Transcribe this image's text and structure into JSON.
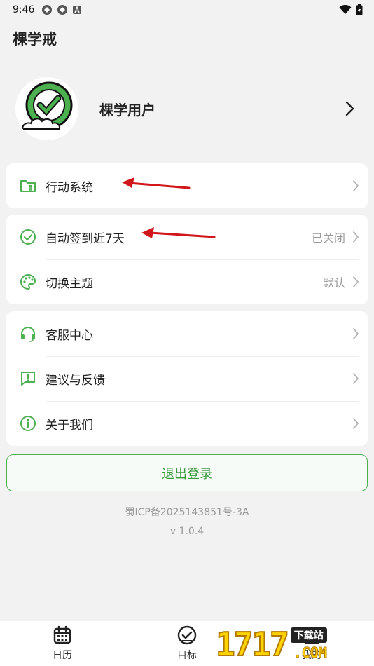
{
  "status_bar": {
    "time": "9:46"
  },
  "app": {
    "title": "棵学戒"
  },
  "profile": {
    "name": "棵学用户"
  },
  "menu_groups": [
    {
      "items": [
        {
          "label": "行动系统",
          "value": ""
        }
      ]
    },
    {
      "items": [
        {
          "label": "自动签到近7天",
          "value": "已关闭"
        },
        {
          "label": "切换主题",
          "value": "默认"
        }
      ]
    },
    {
      "items": [
        {
          "label": "客服中心",
          "value": ""
        },
        {
          "label": "建议与反馈",
          "value": ""
        },
        {
          "label": "关于我们",
          "value": ""
        }
      ]
    }
  ],
  "logout": {
    "label": "退出登录"
  },
  "footer": {
    "icp": "蜀ICP备2025143851号-3A",
    "version": "v 1.0.4"
  },
  "bottom_nav": [
    {
      "label": "日历",
      "icon": "calendar-icon"
    },
    {
      "label": "目标",
      "icon": "target-check-icon"
    },
    {
      "label": "我的",
      "icon": "person-icon"
    }
  ],
  "watermark": {
    "digits": "1717",
    "badge": "下载站",
    "domain": ".COM"
  },
  "colors": {
    "accent": "#4caf50",
    "annotation_arrow": "#d0161b",
    "background": "#f2f2f2"
  }
}
